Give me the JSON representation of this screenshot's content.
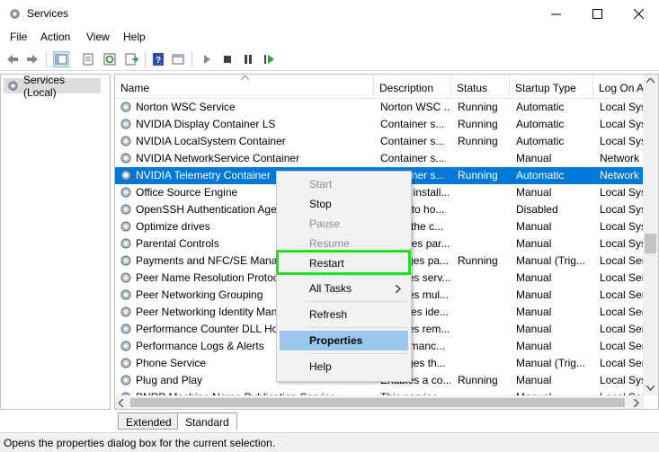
{
  "window": {
    "title": "Services"
  },
  "menubar": [
    "File",
    "Action",
    "View",
    "Help"
  ],
  "tree": {
    "item": "Services (Local)"
  },
  "columns": [
    "Name",
    "Description",
    "Status",
    "Startup Type",
    "Log On As"
  ],
  "rows": [
    {
      "name": "Norton WSC Service",
      "description": "Norton WSC ...",
      "status": "Running",
      "startup": "Automatic",
      "logon": "Local Syst"
    },
    {
      "name": "NVIDIA Display Container LS",
      "description": "Container s...",
      "status": "Running",
      "startup": "Automatic",
      "logon": "Local Syst"
    },
    {
      "name": "NVIDIA LocalSystem Container",
      "description": "Container s...",
      "status": "Running",
      "startup": "Automatic",
      "logon": "Local Syst"
    },
    {
      "name": "NVIDIA NetworkService Container",
      "description": "Container s...",
      "status": "",
      "startup": "Manual",
      "logon": "Network S"
    },
    {
      "name": "NVIDIA Telemetry Container",
      "description": "Container s...",
      "status": "Running",
      "startup": "Automatic",
      "logon": "Network S",
      "selected": true
    },
    {
      "name": "Office  Source Engine",
      "description": "Saves install...",
      "status": "",
      "startup": "Manual",
      "logon": "Local Syst"
    },
    {
      "name": "OpenSSH Authentication Agent",
      "description": "Agent to ho...",
      "status": "",
      "startup": "Disabled",
      "logon": "Local Syst"
    },
    {
      "name": "Optimize drives",
      "description": "Helps the c...",
      "status": "",
      "startup": "Manual",
      "logon": "Local Syst"
    },
    {
      "name": "Parental Controls",
      "description": "Enforces par...",
      "status": "",
      "startup": "Manual",
      "logon": "Local Syst"
    },
    {
      "name": "Payments and NFC/SE Manager",
      "description": "Manages pa...",
      "status": "Running",
      "startup": "Manual (Trig...",
      "logon": "Local Serv"
    },
    {
      "name": "Peer Name Resolution Protocol",
      "description": "Enables serv...",
      "status": "",
      "startup": "Manual",
      "logon": "Local Serv"
    },
    {
      "name": "Peer Networking Grouping",
      "description": "Enables mul...",
      "status": "",
      "startup": "Manual",
      "logon": "Local Serv"
    },
    {
      "name": "Peer Networking Identity Manager",
      "description": "Provides ide...",
      "status": "",
      "startup": "Manual",
      "logon": "Local Serv"
    },
    {
      "name": "Performance Counter DLL Host",
      "description": "Enables rem...",
      "status": "",
      "startup": "Manual",
      "logon": "Local Serv"
    },
    {
      "name": "Performance Logs & Alerts",
      "description": "Performanc...",
      "status": "",
      "startup": "Manual",
      "logon": "Local Serv"
    },
    {
      "name": "Phone Service",
      "description": "Manages th...",
      "status": "",
      "startup": "Manual (Trig...",
      "logon": "Local Serv"
    },
    {
      "name": "Plug and Play",
      "description": "Enables a co...",
      "status": "Running",
      "startup": "Manual",
      "logon": "Local Syst"
    },
    {
      "name": "PNRP Machine Name Publication Service",
      "description": "This service ...",
      "status": "",
      "startup": "Manual",
      "logon": "Local Serv"
    }
  ],
  "context_menu": [
    {
      "label": "Start",
      "disabled": true
    },
    {
      "label": "Stop",
      "disabled": false
    },
    {
      "label": "Pause",
      "disabled": true
    },
    {
      "label": "Resume",
      "disabled": true
    },
    {
      "label": "Restart",
      "disabled": false,
      "outlined": true
    },
    {
      "label": "All Tasks",
      "disabled": false,
      "submenu": true
    },
    {
      "label": "Refresh",
      "disabled": false
    },
    {
      "label": "Properties",
      "disabled": false,
      "highlighted": true
    },
    {
      "label": "Help",
      "disabled": false
    }
  ],
  "tabs": [
    "Extended",
    "Standard"
  ],
  "status_text": "Opens the properties dialog box for the current selection.",
  "colors": {
    "selection": "#0078d7",
    "menu_highlight": "#99c7ee",
    "outline": "#22e022"
  }
}
